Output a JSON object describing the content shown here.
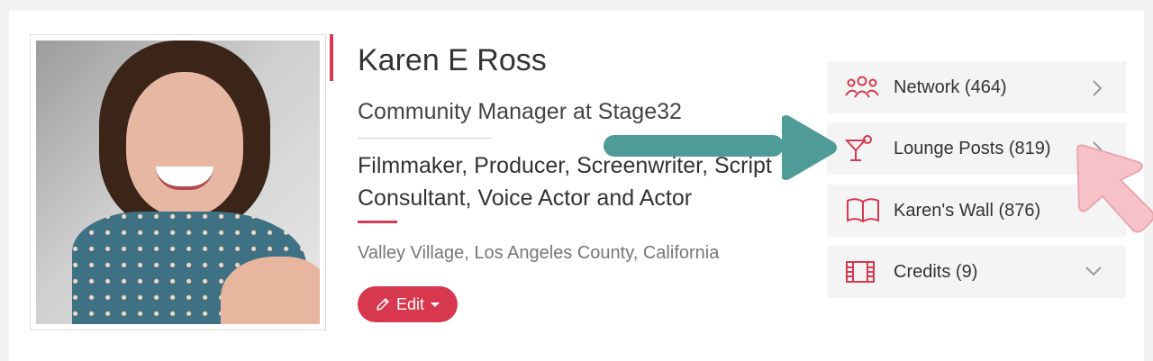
{
  "profile": {
    "name": "Karen E Ross",
    "title": "Community Manager at Stage32",
    "roles": "Filmmaker, Producer, Screenwriter, Script Consultant, Voice Actor and Actor",
    "location": "Valley Village, Los Angeles County, California",
    "edit_label": "Edit",
    "photo_icon": "profile-photo"
  },
  "sidebar": {
    "items": [
      {
        "label": "Network (464)",
        "icon": "network-icon",
        "chevron": "chevron-right-icon"
      },
      {
        "label": "Lounge Posts (819)",
        "icon": "cocktail-icon",
        "chevron": "chevron-right-icon"
      },
      {
        "label": "Karen's Wall (876)",
        "icon": "book-icon",
        "chevron": ""
      },
      {
        "label": "Credits (9)",
        "icon": "film-icon",
        "chevron": "chevron-down-icon"
      }
    ]
  },
  "colors": {
    "accent": "#d63a52",
    "teal_arrow": "#4f9b98",
    "pink_arrow": "#f6c1c7",
    "sidebar_bg": "#f4f4f4"
  }
}
